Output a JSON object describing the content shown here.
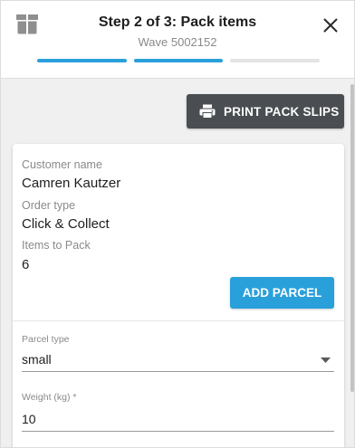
{
  "header": {
    "title": "Step 2 of 3: Pack items",
    "subtitle": "Wave 5002152",
    "progress": {
      "total_steps": 3,
      "completed_steps": 2,
      "active_color": "#2aa0db",
      "inactive_color": "#e4e4e4"
    },
    "icons": {
      "left": "package-box-icon",
      "close": "close-icon"
    }
  },
  "toolbar": {
    "print_label": "PRINT PACK SLIPS",
    "print_icon": "printer-icon"
  },
  "order": {
    "customer_name_label": "Customer name",
    "customer_name": "Camren Kautzer",
    "order_type_label": "Order type",
    "order_type": "Click & Collect",
    "items_label": "Items to Pack",
    "items_count": "6",
    "add_parcel_label": "ADD PARCEL"
  },
  "parcel": {
    "type_label": "Parcel type",
    "type_value": "small",
    "weight_label": "Weight (kg) *",
    "weight_value": "10"
  },
  "colors": {
    "accent": "#2aa0db",
    "dark_button": "#4a4e52",
    "muted_text": "#8a8a8a"
  }
}
